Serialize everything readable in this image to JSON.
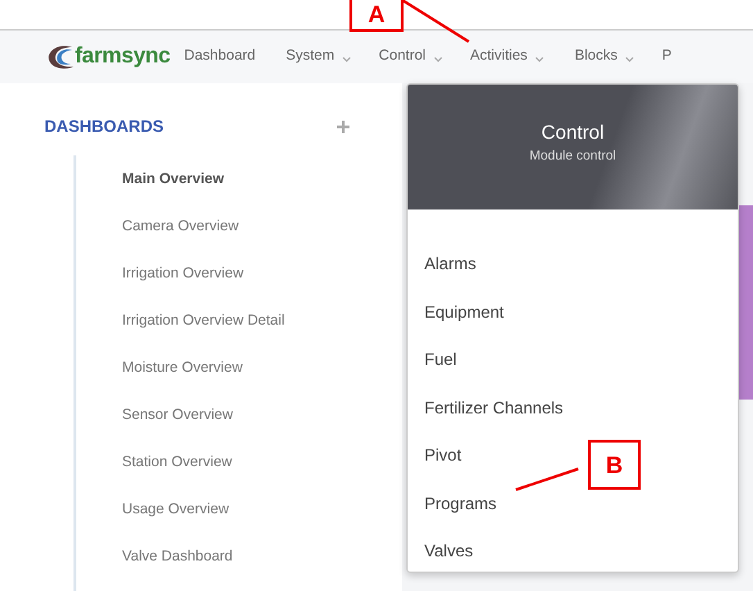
{
  "navbar": {
    "logo": "farmsync",
    "items": [
      {
        "label": "Dashboard",
        "has_caret": false
      },
      {
        "label": "System",
        "has_caret": true
      },
      {
        "label": "Control",
        "has_caret": true
      },
      {
        "label": "Activities",
        "has_caret": true
      },
      {
        "label": "Blocks",
        "has_caret": true
      },
      {
        "label": "P",
        "has_caret": false
      }
    ]
  },
  "sidebar": {
    "title": "DASHBOARDS",
    "items": [
      {
        "label": "Main Overview",
        "selected": true
      },
      {
        "label": "Camera Overview",
        "selected": false
      },
      {
        "label": "Irrigation Overview",
        "selected": false
      },
      {
        "label": "Irrigation Overview Detail",
        "selected": false
      },
      {
        "label": "Moisture Overview",
        "selected": false
      },
      {
        "label": "Sensor Overview",
        "selected": false
      },
      {
        "label": "Station Overview",
        "selected": false
      },
      {
        "label": "Usage Overview",
        "selected": false
      },
      {
        "label": "Valve Dashboard",
        "selected": false
      }
    ]
  },
  "dropdown": {
    "title": "Control",
    "subtitle": "Module control",
    "items": [
      {
        "label": "Alarms"
      },
      {
        "label": "Equipment"
      },
      {
        "label": "Fuel"
      },
      {
        "label": "Fertilizer Channels"
      },
      {
        "label": "Pivot"
      },
      {
        "label": "Programs"
      },
      {
        "label": "Valves"
      }
    ]
  },
  "annotations": [
    {
      "label": "A"
    },
    {
      "label": "B"
    }
  ]
}
